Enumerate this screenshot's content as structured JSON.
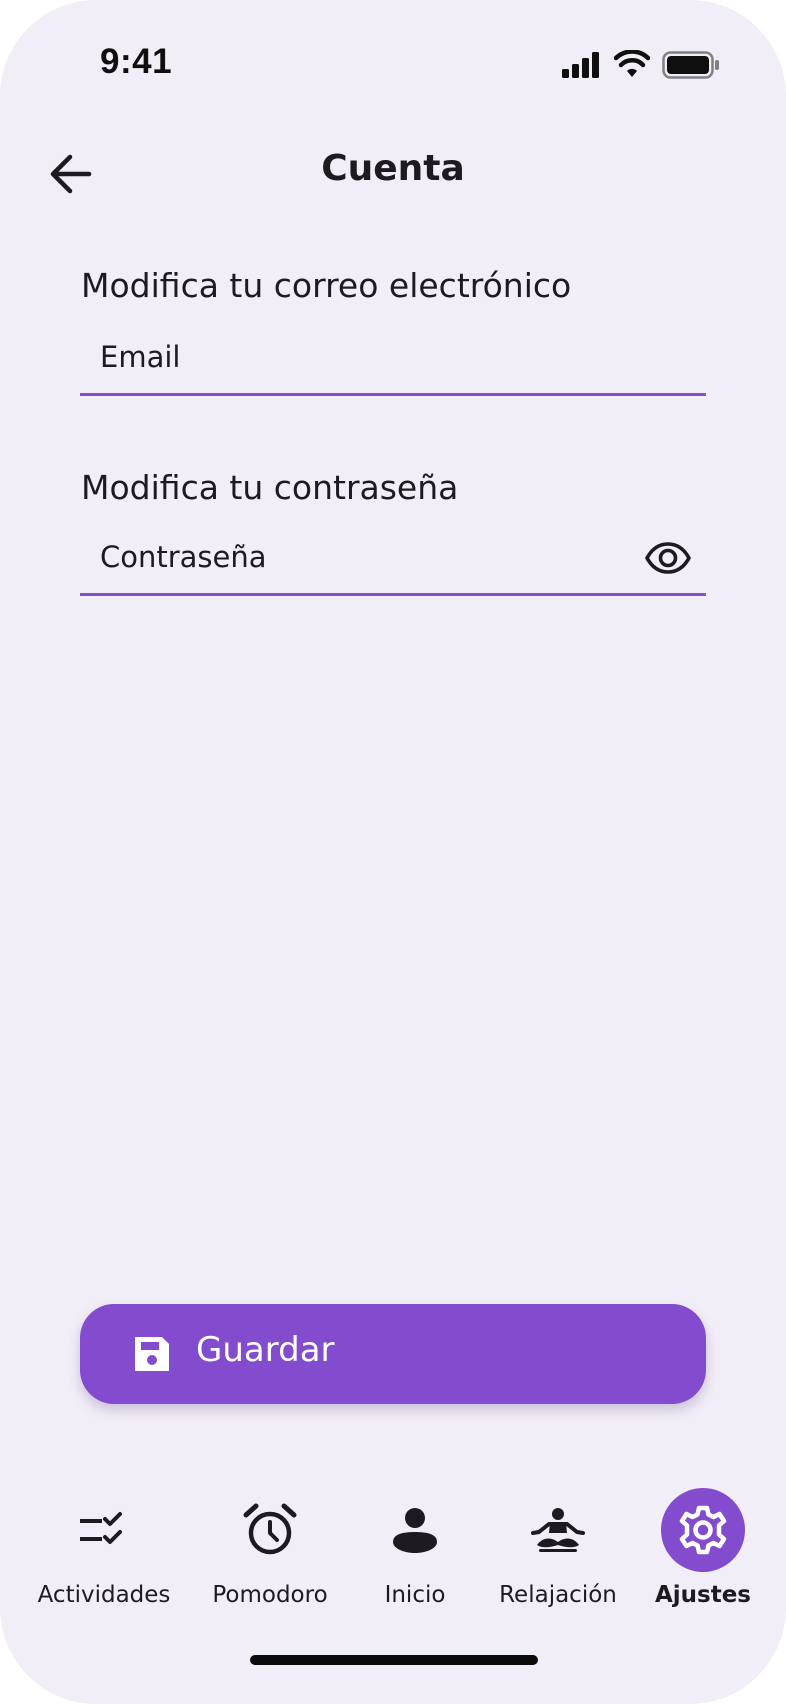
{
  "status_bar": {
    "time": "9:41",
    "icons": [
      "cellular-signal-icon",
      "wifi-icon",
      "battery-icon"
    ]
  },
  "header": {
    "title": "Cuenta",
    "back_icon": "arrow-left-icon"
  },
  "form": {
    "email": {
      "label": "Modifica tu correo electrónico",
      "placeholder": "Email",
      "value": ""
    },
    "password": {
      "label": "Modifica tu contraseña",
      "placeholder": "Contraseña",
      "value": "",
      "toggle_icon": "eye-icon"
    }
  },
  "save_button": {
    "label": "Guardar",
    "icon": "save-icon",
    "color": "#834ccf"
  },
  "bottom_nav": {
    "active_index": 4,
    "accent_color": "#834ccf",
    "items": [
      {
        "label": "Actividades",
        "icon": "task-list-icon"
      },
      {
        "label": "Pomodoro",
        "icon": "alarm-clock-icon"
      },
      {
        "label": "Inicio",
        "icon": "person-icon"
      },
      {
        "label": "Relajación",
        "icon": "meditation-icon"
      },
      {
        "label": "Ajustes",
        "icon": "gear-icon"
      }
    ]
  },
  "colors": {
    "background": "#f2eef7",
    "field_underline": "#8251d0",
    "text": "#1d1b20"
  }
}
